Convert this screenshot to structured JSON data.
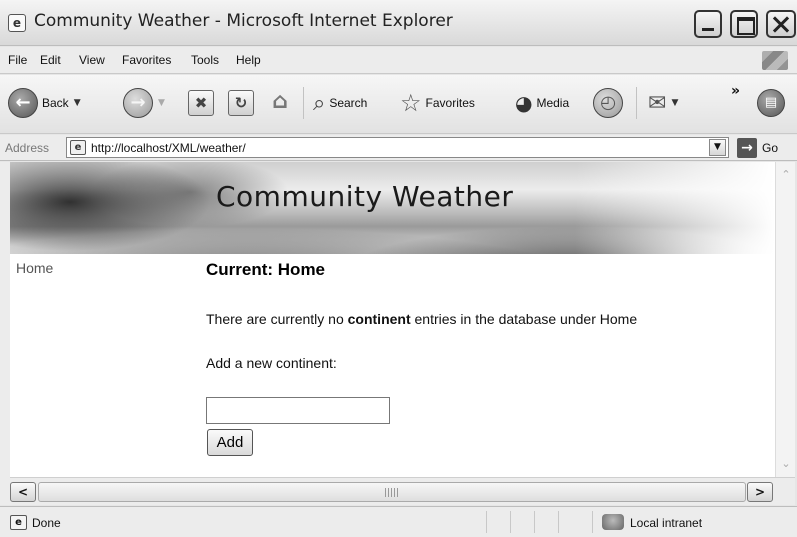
{
  "window": {
    "title": "Community Weather - Microsoft Internet Explorer",
    "icon": "ie-page-icon"
  },
  "menu": [
    "File",
    "Edit",
    "View",
    "Favorites",
    "Tools",
    "Help"
  ],
  "toolbar": {
    "back_label": "Back",
    "search_label": "Search",
    "favorites_label": "Favorites",
    "media_label": "Media",
    "more": "»"
  },
  "address": {
    "label": "Address",
    "url": "http://localhost/XML/weather/",
    "go_label": "Go"
  },
  "page": {
    "banner_title": "Community Weather",
    "nav_home": "Home",
    "heading": "Current: Home",
    "msg_before": "There are currently no ",
    "msg_bold": "continent",
    "msg_after": " entries in the database under Home",
    "add_label": "Add a new continent:",
    "input_value": "",
    "add_button": "Add"
  },
  "status": {
    "text": "Done",
    "zone": "Local intranet"
  },
  "colors": {
    "chrome": "#ececec",
    "content_bg": "#ffffff",
    "text": "#111111"
  }
}
